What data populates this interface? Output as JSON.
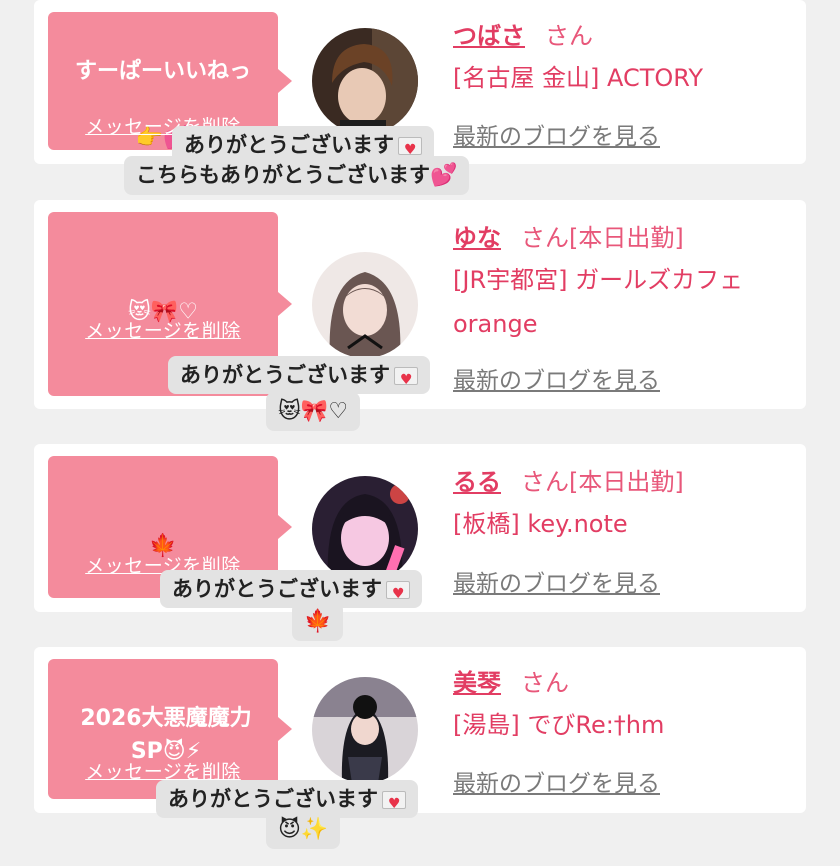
{
  "delete_label": "メッセージを削除",
  "blog_label": "最新のブログを見る",
  "accent_color": "#e23d63",
  "bubble_color": "#f48b9c",
  "cards": [
    {
      "message": "すーぱーいいねっ",
      "message_emoji": "👉💕",
      "name": "つばさ",
      "suffix": "さん",
      "shop": "[名古屋 金山] ACTORY",
      "replies": [
        {
          "text": "ありがとうございます",
          "icon": "love-letter-icon"
        },
        {
          "text": "こちらもありがとうございます",
          "emoji": "💕"
        }
      ]
    },
    {
      "message_emoji": "😻🎀♡",
      "name": "ゆな",
      "suffix": "さん[本日出勤]",
      "shop": "[JR宇都宮] ガールズカフェ orange",
      "replies": [
        {
          "text": "ありがとうございます",
          "icon": "love-letter-icon"
        },
        {
          "text": "",
          "emoji": "😻🎀♡"
        }
      ]
    },
    {
      "message_emoji": "🍁",
      "name": "るる",
      "suffix": "さん[本日出勤]",
      "shop": "[板橋] key.note",
      "replies": [
        {
          "text": "ありがとうございます",
          "icon": "love-letter-icon"
        },
        {
          "text": "",
          "emoji": "🍁"
        }
      ]
    },
    {
      "message": "2026大悪魔魔力SP😈⚡",
      "name": "美琴",
      "suffix": "さん",
      "shop": "[湯島] でびRe:†hm",
      "replies": [
        {
          "text": "ありがとうございます",
          "icon": "love-letter-icon"
        },
        {
          "text": "",
          "emoji": "😈✨"
        }
      ]
    }
  ]
}
